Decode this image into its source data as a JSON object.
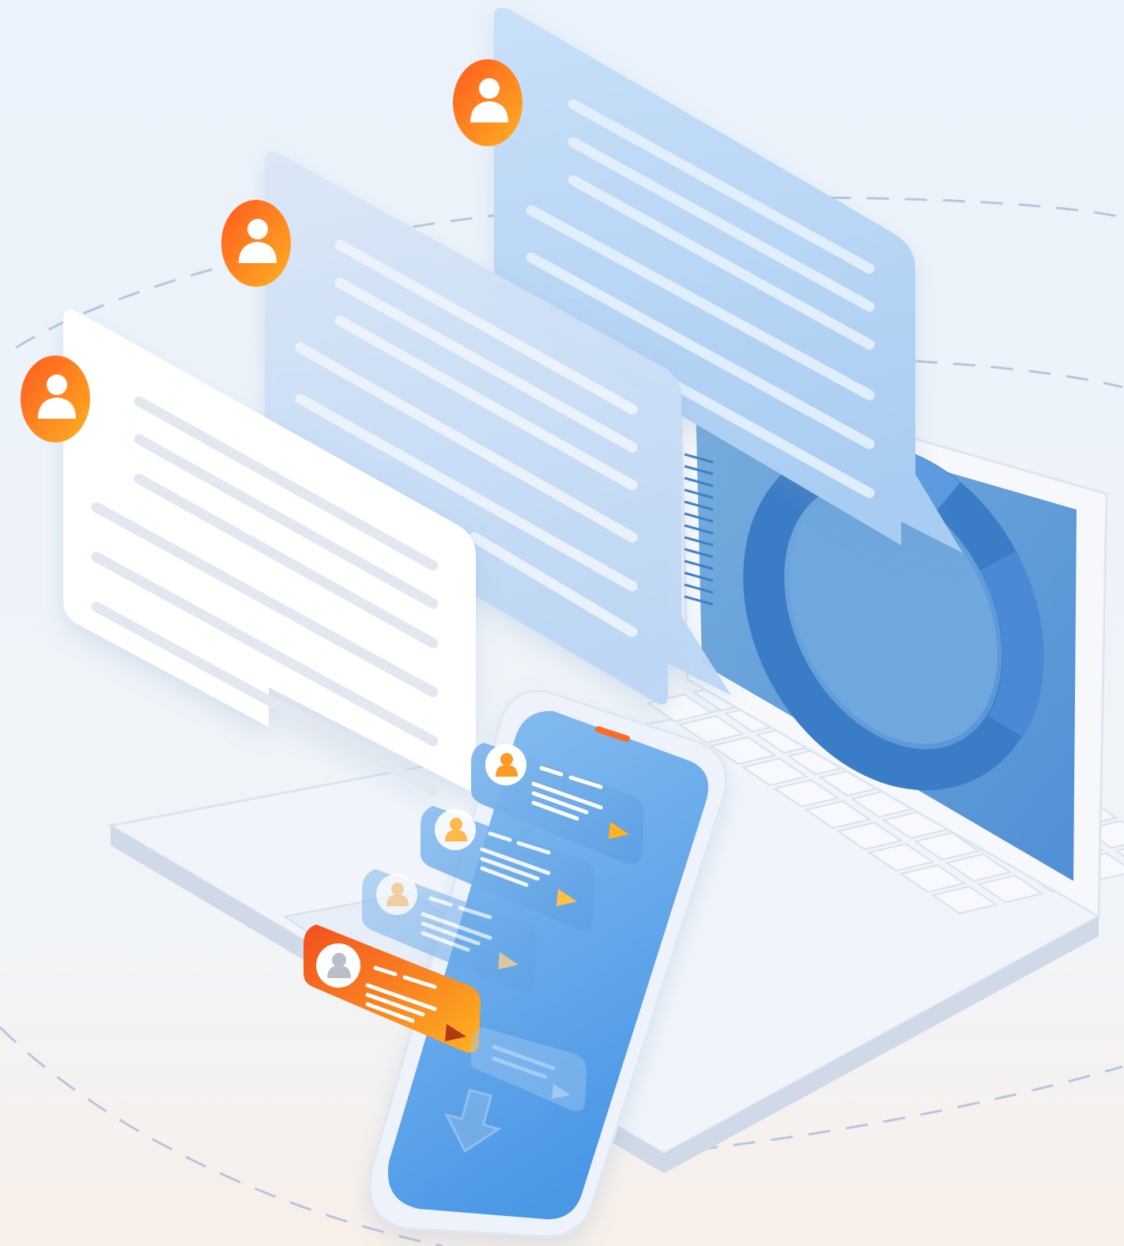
{
  "scene": {
    "description_label": "",
    "palette": {
      "background_top": "#eef4fb",
      "background_bottom": "#f7f2ee",
      "laptop_body": "#f3f6fb",
      "laptop_screen": "#5a98d8",
      "laptop_screen_dark": "#3f7fc8",
      "card_white": "#ffffff",
      "card_blue_light": "#cfe1f7",
      "card_blue": "#b9d7f6",
      "phone_screen": "#5ea2e6",
      "accent_orange": "#ff7a1a",
      "accent_orange_dark": "#f0531e",
      "accent_yellow": "#ffb321",
      "dashed_line": "#b9c6dc"
    }
  },
  "laptop": {
    "keyboard_rows": 5,
    "keys_per_row": 10,
    "screen_chart": "donut"
  },
  "chat_cards": [
    {
      "id": "card-front",
      "style": "white",
      "text_lines": 6,
      "avatar": "person-icon"
    },
    {
      "id": "card-middle",
      "style": "blue-light",
      "text_lines": 8,
      "avatar": "person-icon"
    },
    {
      "id": "card-back",
      "style": "blue",
      "text_lines": 8,
      "avatar": "person-icon"
    }
  ],
  "phone": {
    "messages": [
      {
        "id": "msg-1",
        "style": "blue",
        "avatar": "person-icon",
        "send_icon": "send-icon"
      },
      {
        "id": "msg-2",
        "style": "blue",
        "avatar": "person-icon",
        "send_icon": "send-icon"
      },
      {
        "id": "msg-3",
        "style": "blue-faded",
        "avatar": "person-icon",
        "send_icon": "send-icon"
      },
      {
        "id": "msg-4",
        "style": "orange",
        "avatar": "person-icon",
        "send_icon": "send-icon"
      },
      {
        "id": "msg-5",
        "style": "blue-faded",
        "avatar": "",
        "send_icon": "send-icon"
      }
    ],
    "bottom_icon": "download-arrow-icon"
  }
}
